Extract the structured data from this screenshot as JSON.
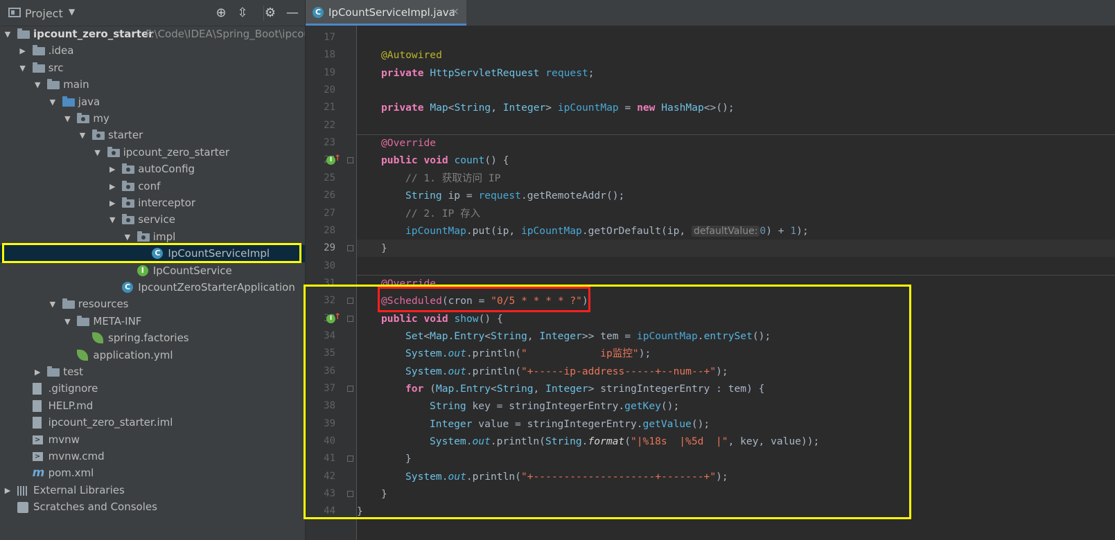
{
  "project_panel": {
    "title": "Project",
    "icons": [
      "locate-icon",
      "collapse-icon",
      "gear-icon",
      "minimize-icon"
    ]
  },
  "tree": [
    {
      "label": "ipcount_zero_starter",
      "path": "F:\\Code\\IDEA\\Spring_Boot\\ipcou",
      "icon": "module-folder-icon",
      "expanded": true,
      "depth": 0
    },
    {
      "label": ".idea",
      "icon": "folder-icon",
      "expanded": false,
      "depth": 1
    },
    {
      "label": "src",
      "icon": "folder-icon",
      "expanded": true,
      "depth": 1
    },
    {
      "label": "main",
      "icon": "folder-icon",
      "expanded": true,
      "depth": 2
    },
    {
      "label": "java",
      "icon": "source-folder-icon",
      "expanded": true,
      "depth": 3
    },
    {
      "label": "my",
      "icon": "package-icon",
      "expanded": true,
      "depth": 4
    },
    {
      "label": "starter",
      "icon": "package-icon",
      "expanded": true,
      "depth": 5
    },
    {
      "label": "ipcount_zero_starter",
      "icon": "package-icon",
      "expanded": true,
      "depth": 6
    },
    {
      "label": "autoConfig",
      "icon": "package-icon",
      "expanded": false,
      "depth": 7
    },
    {
      "label": "conf",
      "icon": "package-icon",
      "expanded": false,
      "depth": 7
    },
    {
      "label": "interceptor",
      "icon": "package-icon",
      "expanded": false,
      "depth": 7
    },
    {
      "label": "service",
      "icon": "package-icon",
      "expanded": true,
      "depth": 7
    },
    {
      "label": "impl",
      "icon": "package-icon",
      "expanded": true,
      "depth": 8
    },
    {
      "label": "IpCountServiceImpl",
      "icon": "class-icon",
      "depth": 9,
      "selected": true
    },
    {
      "label": "IpCountService",
      "icon": "interface-icon",
      "depth": 8
    },
    {
      "label": "IpcountZeroStarterApplication",
      "icon": "spring-boot-class-icon",
      "depth": 7
    },
    {
      "label": "resources",
      "icon": "resources-folder-icon",
      "expanded": true,
      "depth": 3
    },
    {
      "label": "META-INF",
      "icon": "folder-icon",
      "expanded": true,
      "depth": 4
    },
    {
      "label": "spring.factories",
      "icon": "spring-icon",
      "depth": 5
    },
    {
      "label": "application.yml",
      "icon": "spring-config-icon",
      "depth": 4
    },
    {
      "label": "test",
      "icon": "folder-icon",
      "expanded": false,
      "depth": 2
    },
    {
      "label": ".gitignore",
      "icon": "file-icon",
      "depth": 1
    },
    {
      "label": "HELP.md",
      "icon": "markdown-icon",
      "depth": 1
    },
    {
      "label": "ipcount_zero_starter.iml",
      "icon": "iml-icon",
      "depth": 1
    },
    {
      "label": "mvnw",
      "icon": "terminal-icon",
      "depth": 1
    },
    {
      "label": "mvnw.cmd",
      "icon": "terminal-icon",
      "depth": 1
    },
    {
      "label": "pom.xml",
      "icon": "maven-icon",
      "depth": 1
    },
    {
      "label": "External Libraries",
      "icon": "library-icon",
      "expanded": false,
      "depth": 0
    },
    {
      "label": "Scratches and Consoles",
      "icon": "scratch-icon",
      "depth": 0
    }
  ],
  "editor": {
    "tab": {
      "label": "IpCountServiceImpl.java",
      "close": "×"
    },
    "hint_default_value": "defaultValue:",
    "lines": [
      {
        "n": "17"
      },
      {
        "n": "18",
        "t": [
          "@Autowired"
        ]
      },
      {
        "n": "19",
        "t": [
          "private",
          " ",
          "HttpServletRequest",
          " ",
          "request",
          ";"
        ]
      },
      {
        "n": "20"
      },
      {
        "n": "21",
        "t": [
          "private",
          " ",
          "Map",
          "<",
          "String",
          ", ",
          "Integer",
          "> ",
          "ipCountMap",
          " = ",
          "new",
          " ",
          "HashMap",
          "<>();"
        ]
      },
      {
        "n": "22"
      },
      {
        "n": "23",
        "t": [
          "@Override"
        ]
      },
      {
        "n": "24",
        "t": [
          "public void",
          " ",
          "count",
          "() {"
        ]
      },
      {
        "n": "25",
        "t": [
          "// 1. 获取访问 IP"
        ]
      },
      {
        "n": "26",
        "t": [
          "String",
          " ip = ",
          "request",
          ".getRemoteAddr();"
        ]
      },
      {
        "n": "27",
        "t": [
          "// 2. IP 存入"
        ]
      },
      {
        "n": "28",
        "t": [
          "ipCountMap",
          ".put(ip, ",
          "ipCountMap",
          ".getOrDefault(ip, ",
          "0",
          ") + ",
          "1",
          ");"
        ]
      },
      {
        "n": "29",
        "t": [
          "}"
        ]
      },
      {
        "n": "30"
      },
      {
        "n": "31",
        "t": [
          "@Override"
        ]
      },
      {
        "n": "32",
        "t": [
          "@Scheduled",
          "(cron = ",
          "\"0/5 * * * * ?\"",
          ")"
        ]
      },
      {
        "n": "33",
        "t": [
          "public void",
          " ",
          "show",
          "() {"
        ]
      },
      {
        "n": "34",
        "t": [
          "Set",
          "<",
          "Map.Entry",
          "<",
          "String",
          ", ",
          "Integer",
          ">> tem = ",
          "ipCountMap",
          ".",
          "entrySet",
          "();"
        ]
      },
      {
        "n": "35",
        "t": [
          "System.",
          "out",
          ".println(",
          "\"            ip监控\"",
          ");"
        ]
      },
      {
        "n": "36",
        "t": [
          "System.",
          "out",
          ".println(",
          "\"+-----ip-address-----+--num--+\"",
          ");"
        ]
      },
      {
        "n": "37",
        "t": [
          "for",
          " (",
          "Map.Entry",
          "<",
          "String",
          ", ",
          "Integer",
          "> stringIntegerEntry : tem) {"
        ]
      },
      {
        "n": "38",
        "t": [
          "String",
          " key = stringIntegerEntry.",
          "getKey",
          "();"
        ]
      },
      {
        "n": "39",
        "t": [
          "Integer",
          " value = stringIntegerEntry.",
          "getValue",
          "();"
        ]
      },
      {
        "n": "40",
        "t": [
          "System.",
          "out",
          ".println(",
          "String",
          ".",
          "format",
          "(",
          "\"|%18s  |%5d  |\"",
          ", key, value));"
        ]
      },
      {
        "n": "41",
        "t": [
          "}"
        ]
      },
      {
        "n": "42",
        "t": [
          "System.",
          "out",
          ".println(",
          "\"+--------------------+-------+\"",
          ");"
        ]
      },
      {
        "n": "43",
        "t": [
          "}"
        ]
      },
      {
        "n": "44",
        "t": [
          "}"
        ]
      }
    ]
  },
  "colors": {
    "highlight_yellow": "#ffff00",
    "highlight_red": "#ff2020",
    "editor_bg": "#2b2b2b",
    "panel_bg": "#3c3f41"
  }
}
